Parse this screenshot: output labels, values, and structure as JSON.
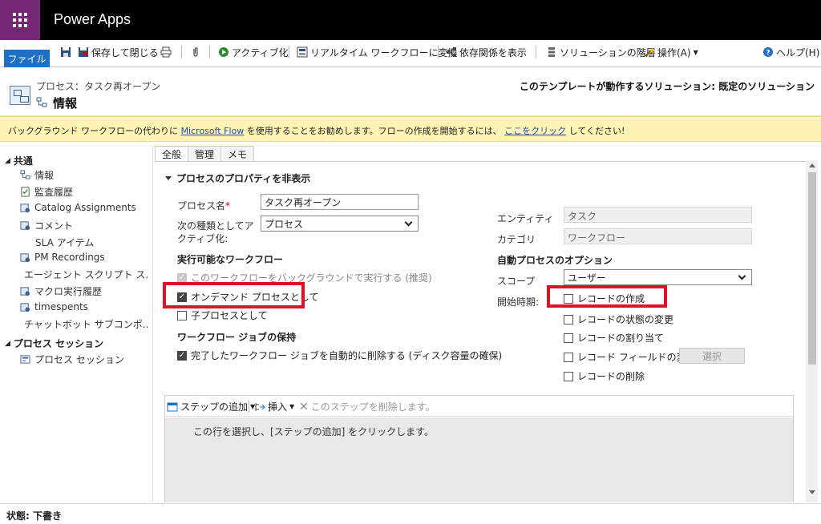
{
  "app": {
    "title": "Power Apps"
  },
  "ribbon": {
    "file_tab": "ファイル",
    "save_close": "保存して閉じる",
    "activate": "アクティブ化",
    "convert_realtime": "リアルタイム ワークフローに変換",
    "show_dependencies": "依存関係を表示",
    "solution_layers": "ソリューションの階層",
    "actions": "操作(A)",
    "help": "ヘルプ(H)"
  },
  "header": {
    "breadcrumb": "プロセス：タスク再オープン",
    "title": "情報",
    "solution_label": "このテンプレートが動作するソリューション: 既定のソリューション"
  },
  "notification": {
    "prefix": "バックグラウンド ワークフローの代わりに",
    "link1": "Microsoft Flow",
    "middle": "を使用することをお勧めします。フローの作成を開始するには、",
    "link2": "ここをクリック",
    "suffix": "してください!"
  },
  "sidebar": {
    "group_common": "共通",
    "items": [
      {
        "label": "情報"
      },
      {
        "label": "監査履歴"
      },
      {
        "label": "Catalog Assignments"
      },
      {
        "label": "コメント"
      },
      {
        "label": "SLA アイテム"
      },
      {
        "label": "PM Recordings"
      },
      {
        "label": "エージェント スクリプト ス..."
      },
      {
        "label": "マクロ実行履歴"
      },
      {
        "label": "timespents"
      },
      {
        "label": "チャットボット サブコンポ..."
      }
    ],
    "group_session": "プロセス セッション",
    "session_item": "プロセス セッション"
  },
  "tabs": [
    "全般",
    "管理",
    "メモ"
  ],
  "form": {
    "section_toggle": "プロセスのプロパティを非表示",
    "process_name_label": "プロセス名",
    "required_mark": "*",
    "process_name_value": "タスク再オープン",
    "activate_as_label": "次の種類としてアクティブ化:",
    "activate_as_value": "プロセス",
    "entity_label": "エンティティ",
    "entity_value": "タスク",
    "category_label": "カテゴリ",
    "category_value": "ワークフロー",
    "runnable_heading": "実行可能なワークフロー",
    "run_background": "このワークフローをバックグラウンドで実行する (推奨)",
    "on_demand": "オンデマンド プロセスとして",
    "as_child": "子プロセスとして",
    "retention_heading": "ワークフロー ジョブの保持",
    "auto_delete": "完了したワークフロー ジョブを自動的に削除する (ディスク容量の確保)",
    "auto_options_heading": "自動プロセスのオプション",
    "scope_label": "スコープ",
    "scope_value": "ユーザー",
    "start_when_label": "開始時期:",
    "start_options": [
      "レコードの作成",
      "レコードの状態の変更",
      "レコードの割り当て",
      "レコード フィールドの変更",
      "レコードの削除"
    ],
    "select_button": "選択"
  },
  "steps": {
    "add_step": "ステップの追加",
    "insert": "挿入",
    "delete_step": "このステップを削除します。",
    "hint": "この行を選択し、[ステップの追加] をクリックします。"
  },
  "status": {
    "text": "状態: 下書き"
  },
  "colors": {
    "brand": "#742774",
    "highlight": "#e0122a",
    "file_tab": "#1f6fc5",
    "notify_bg": "#fff4b3"
  }
}
